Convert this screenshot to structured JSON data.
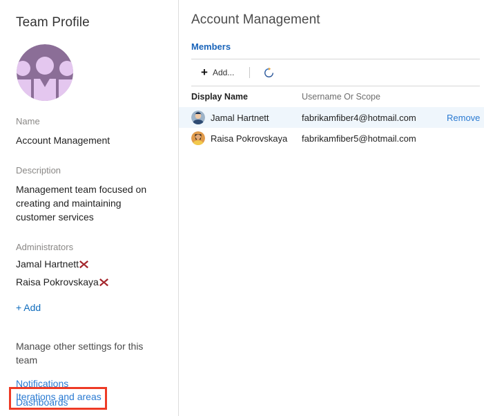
{
  "sidebar": {
    "title": "Team Profile",
    "avatar_icon": "team-avatar-icon",
    "name_label": "Name",
    "name_value": "Account Management",
    "description_label": "Description",
    "description_value": "Management team focused on creating and maintaining customer services",
    "administrators_label": "Administrators",
    "administrators": [
      {
        "name": "Jamal Hartnett",
        "remove_icon": "remove-x-icon"
      },
      {
        "name": "Raisa Pokrovskaya",
        "remove_icon": "remove-x-icon"
      }
    ],
    "add_admin_label": "+ Add",
    "manage_text": "Manage other settings for this team",
    "links": [
      {
        "label": "Notifications"
      },
      {
        "label": "Dashboards"
      },
      {
        "label": "Iterations and areas"
      }
    ],
    "highlighted_link_index": 2
  },
  "main": {
    "title": "Account Management",
    "pivot": {
      "label": "Members"
    },
    "toolbar": {
      "add_label": "Add...",
      "add_icon": "plus-icon",
      "refresh_icon": "refresh-icon"
    },
    "table": {
      "columns": [
        "Display Name",
        "Username Or Scope"
      ],
      "rows": [
        {
          "avatar_icon": "user-avatar-icon",
          "display_name": "Jamal Hartnett",
          "username": "fabrikamfiber4@hotmail.com",
          "action": "Remove",
          "selected": true
        },
        {
          "avatar_icon": "user-avatar-icon",
          "display_name": "Raisa Pokrovskaya",
          "username": "fabrikamfiber5@hotmail.com",
          "action": "",
          "selected": false
        }
      ]
    }
  },
  "colors": {
    "link_blue": "#2a7ad2",
    "pivot_blue": "#1964ba",
    "annotation_red": "#ee3a25",
    "remove_x_red": "#a4262c",
    "row_selected": "#eff6fc",
    "avatar_purple_dark": "#8b6e97",
    "avatar_purple_light": "#e4c7ef"
  }
}
